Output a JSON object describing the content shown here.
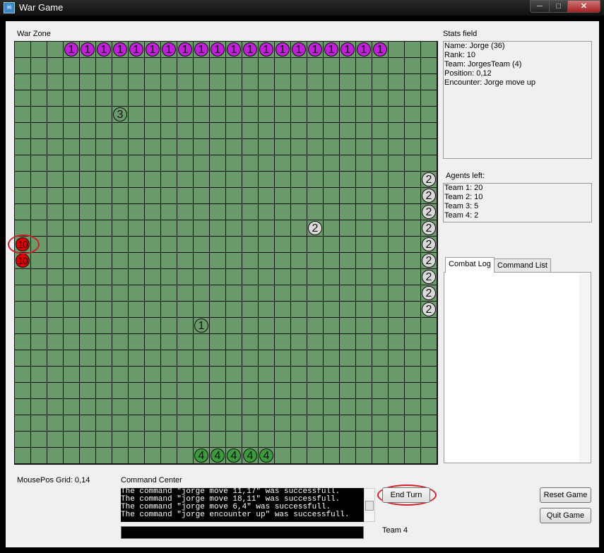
{
  "window": {
    "title": "War Game",
    "min_glyph": "─",
    "max_glyph": "□",
    "close_glyph": "✕",
    "icon_glyph": "☠"
  },
  "war_zone": {
    "label": "War Zone",
    "grid_size": 26
  },
  "agents": [
    {
      "team": "t1",
      "label": "1",
      "col": 3,
      "row": 0
    },
    {
      "team": "t1",
      "label": "1",
      "col": 4,
      "row": 0
    },
    {
      "team": "t1",
      "label": "1",
      "col": 5,
      "row": 0
    },
    {
      "team": "t1",
      "label": "1",
      "col": 6,
      "row": 0
    },
    {
      "team": "t1",
      "label": "1",
      "col": 7,
      "row": 0
    },
    {
      "team": "t1",
      "label": "1",
      "col": 8,
      "row": 0
    },
    {
      "team": "t1",
      "label": "1",
      "col": 9,
      "row": 0
    },
    {
      "team": "t1",
      "label": "1",
      "col": 10,
      "row": 0
    },
    {
      "team": "t1",
      "label": "1",
      "col": 11,
      "row": 0
    },
    {
      "team": "t1",
      "label": "1",
      "col": 12,
      "row": 0
    },
    {
      "team": "t1",
      "label": "1",
      "col": 13,
      "row": 0
    },
    {
      "team": "t1",
      "label": "1",
      "col": 14,
      "row": 0
    },
    {
      "team": "t1",
      "label": "1",
      "col": 15,
      "row": 0
    },
    {
      "team": "t1",
      "label": "1",
      "col": 16,
      "row": 0
    },
    {
      "team": "t1",
      "label": "1",
      "col": 17,
      "row": 0
    },
    {
      "team": "t1",
      "label": "1",
      "col": 18,
      "row": 0
    },
    {
      "team": "t1",
      "label": "1",
      "col": 19,
      "row": 0
    },
    {
      "team": "t1",
      "label": "1",
      "col": 20,
      "row": 0
    },
    {
      "team": "t1",
      "label": "1",
      "col": 21,
      "row": 0
    },
    {
      "team": "t1",
      "label": "1",
      "col": 22,
      "row": 0
    },
    {
      "team": "t3",
      "label": "3",
      "col": 6,
      "row": 4
    },
    {
      "team": "t2",
      "label": "2",
      "col": 25,
      "row": 8
    },
    {
      "team": "t2",
      "label": "2",
      "col": 25,
      "row": 9
    },
    {
      "team": "t2",
      "label": "2",
      "col": 25,
      "row": 10
    },
    {
      "team": "t2",
      "label": "2",
      "col": 25,
      "row": 11
    },
    {
      "team": "t2",
      "label": "2",
      "col": 18,
      "row": 11
    },
    {
      "team": "t2",
      "label": "2",
      "col": 25,
      "row": 12
    },
    {
      "team": "t2",
      "label": "2",
      "col": 25,
      "row": 13
    },
    {
      "team": "t2",
      "label": "2",
      "col": 25,
      "row": 14
    },
    {
      "team": "t2",
      "label": "2",
      "col": 25,
      "row": 15
    },
    {
      "team": "t2",
      "label": "2",
      "col": 25,
      "row": 16
    },
    {
      "team": "t5",
      "label": "10",
      "col": 0,
      "row": 12
    },
    {
      "team": "t5",
      "label": "10",
      "col": 0,
      "row": 13
    },
    {
      "team": "t3",
      "label": "1",
      "col": 11,
      "row": 17
    },
    {
      "team": "t4",
      "label": "4",
      "col": 11,
      "row": 25
    },
    {
      "team": "t4",
      "label": "4",
      "col": 12,
      "row": 25
    },
    {
      "team": "t4",
      "label": "4",
      "col": 13,
      "row": 25
    },
    {
      "team": "t4",
      "label": "4",
      "col": 14,
      "row": 25
    },
    {
      "team": "t4",
      "label": "4",
      "col": 15,
      "row": 25
    }
  ],
  "stats": {
    "label": "Stats field",
    "lines": [
      "Name: Jorge (36)",
      "Rank: 10",
      "Team: JorgesTeam (4)",
      "Position: 0,12",
      "Encounter: Jorge move up"
    ]
  },
  "agents_left": {
    "label": "Agents left:",
    "lines": [
      "Team 1: 20",
      "Team 2: 10",
      "Team 3: 5",
      "Team 4: 2"
    ]
  },
  "tabs": {
    "combat_log": "Combat Log",
    "command_list": "Command List"
  },
  "mouse_pos": "MousePos Grid: 0,14",
  "command_center": {
    "label": "Command Center",
    "lines": [
      "The command \"jorge move 11,17\" was successfull.",
      "The command \"jorge move 18,11\" was successfull.",
      "The command \"jorge move 6,4\" was successfull.",
      "The command \"jorge encounter up\" was successfull."
    ],
    "input_value": ""
  },
  "buttons": {
    "end_turn": "End Turn",
    "reset_game": "Reset Game",
    "quit_game": "Quit Game"
  },
  "team_label": "Team 4"
}
